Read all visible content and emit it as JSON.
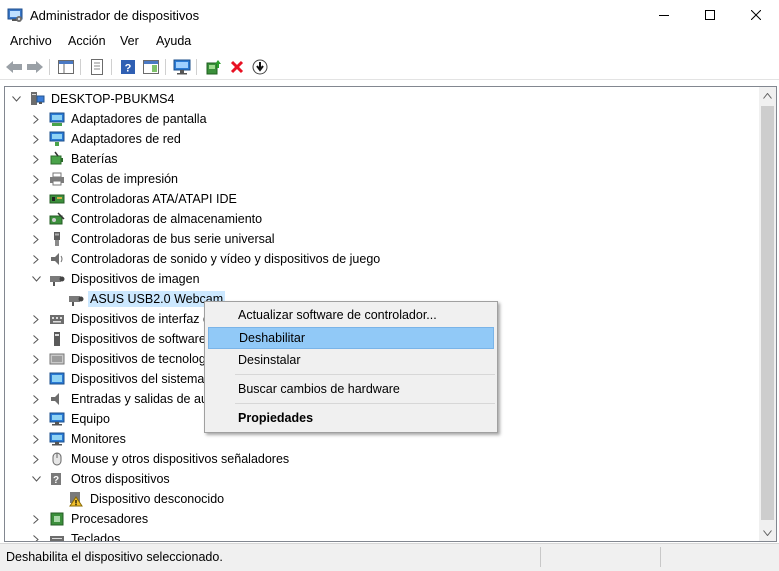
{
  "window": {
    "title": "Administrador de dispositivos",
    "controls": {
      "minimize": "minimize-icon",
      "maximize": "maximize-icon",
      "close": "close-icon"
    }
  },
  "menu": [
    "Archivo",
    "Acción",
    "Ver",
    "Ayuda"
  ],
  "toolbar": [
    "back-arrow-icon",
    "forward-arrow-icon",
    "show-hide-console-tree-icon",
    "properties-icon",
    "help-icon",
    "action-pane-icon",
    "monitor-icon",
    "update-driver-icon",
    "uninstall-x-icon",
    "download-circle-icon"
  ],
  "tree": {
    "root": "DESKTOP-PBUKMS4",
    "items": [
      {
        "label": "Adaptadores de pantalla",
        "icon": "display-adapter-icon",
        "state": "collapsed"
      },
      {
        "label": "Adaptadores de red",
        "icon": "network-adapter-icon",
        "state": "collapsed"
      },
      {
        "label": "Baterías",
        "icon": "battery-icon",
        "state": "collapsed"
      },
      {
        "label": "Colas de impresión",
        "icon": "printer-icon",
        "state": "collapsed"
      },
      {
        "label": "Controladoras ATA/ATAPI IDE",
        "icon": "ide-controller-icon",
        "state": "collapsed"
      },
      {
        "label": "Controladoras de almacenamiento",
        "icon": "storage-controller-icon",
        "state": "collapsed"
      },
      {
        "label": "Controladoras de bus serie universal",
        "icon": "usb-icon",
        "state": "collapsed"
      },
      {
        "label": "Controladoras de sonido y vídeo y dispositivos de juego",
        "icon": "speaker-icon",
        "state": "collapsed"
      },
      {
        "label": "Dispositivos de imagen",
        "icon": "camera-icon",
        "state": "expanded"
      },
      {
        "label": "ASUS USB2.0 Webcam",
        "icon": "webcam-icon",
        "state": "child",
        "selected": true
      },
      {
        "label": "Dispositivos de interfaz de usuario (HID)",
        "icon": "hid-icon",
        "state": "collapsed"
      },
      {
        "label": "Dispositivos de software",
        "icon": "software-device-icon",
        "state": "collapsed"
      },
      {
        "label": "Dispositivos de tecnología de memoria",
        "icon": "memory-technology-icon",
        "state": "collapsed"
      },
      {
        "label": "Dispositivos del sistema",
        "icon": "system-device-icon",
        "state": "collapsed"
      },
      {
        "label": "Entradas y salidas de audio",
        "icon": "audio-io-icon",
        "state": "collapsed"
      },
      {
        "label": "Equipo",
        "icon": "computer-icon",
        "state": "collapsed"
      },
      {
        "label": "Monitores",
        "icon": "monitor-icon",
        "state": "collapsed"
      },
      {
        "label": "Mouse y otros dispositivos señaladores",
        "icon": "mouse-icon",
        "state": "collapsed"
      },
      {
        "label": "Otros dispositivos",
        "icon": "unknown-device-icon",
        "state": "expanded"
      },
      {
        "label": "Dispositivo desconocido",
        "icon": "warning-device-icon",
        "state": "child"
      },
      {
        "label": "Procesadores",
        "icon": "processor-icon",
        "state": "collapsed"
      },
      {
        "label": "Teclados",
        "icon": "keyboard-icon",
        "state": "collapsed"
      }
    ]
  },
  "context_menu": {
    "items": [
      {
        "label": "Actualizar software de controlador...",
        "highlighted": false,
        "bold": false
      },
      {
        "label": "Deshabilitar",
        "highlighted": true,
        "bold": false
      },
      {
        "label": "Desinstalar",
        "highlighted": false,
        "bold": false
      },
      {
        "label": "Buscar cambios de hardware",
        "highlighted": false,
        "bold": false
      },
      {
        "label": "Propiedades",
        "highlighted": false,
        "bold": true
      }
    ]
  },
  "status": {
    "text": "Deshabilita el dispositivo seleccionado."
  },
  "colors": {
    "selection": "#cce8ff",
    "menu_highlight": "#91c9f7",
    "menu_bg": "#f0f0f0",
    "border": "#828790",
    "error_red": "#e81123"
  }
}
